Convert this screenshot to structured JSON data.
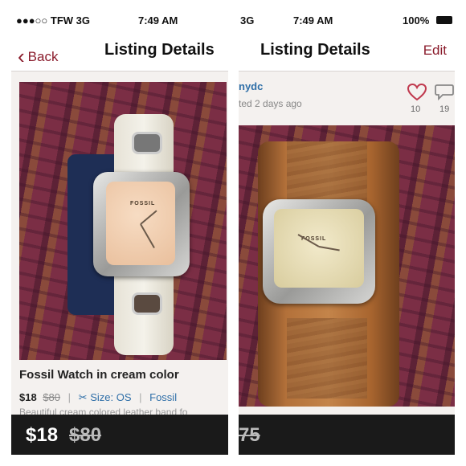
{
  "left": {
    "status": {
      "carrier": "●●●○○ TFW  3G",
      "time": "7:49 AM"
    },
    "nav": {
      "back_label": "Back",
      "title": "Listing Details"
    },
    "listing": {
      "title": "Fossil Watch in cream color",
      "price": "$18",
      "original_price": "$80",
      "size": "Size: OS",
      "brand": "Fossil",
      "description": "Beautiful cream colored leather band fo"
    },
    "watch_logo": "FOSSIL",
    "price_bar": {
      "price": "$18",
      "original_price": "$80"
    }
  },
  "right": {
    "status": {
      "network": "3G",
      "time": "7:49 AM",
      "battery": "100%"
    },
    "nav": {
      "title": "Listing Details",
      "edit_label": "Edit"
    },
    "seller": {
      "username": "nydc",
      "posted": "ted 2 days ago"
    },
    "likes": "10",
    "comments": "19",
    "watch_logo": "FOSSIL",
    "price_bar": {
      "original_price": "75"
    }
  },
  "colors": {
    "accent": "#8a1b2b",
    "link": "#2f6fa8",
    "bar": "#1a1a1a"
  }
}
